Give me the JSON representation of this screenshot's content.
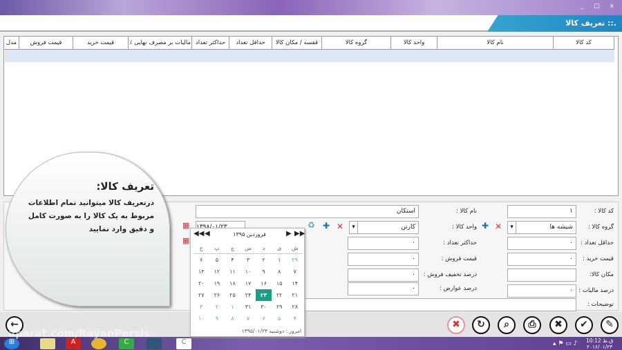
{
  "window": {
    "title": ".:: تعریف کالا",
    "controls": "_ ▢ x"
  },
  "grid": {
    "columns": [
      "مدل",
      "قیمت فروش",
      "قیمت خرید",
      "٪ مالیات بر مصرف نهایی",
      "حداکثر تعداد",
      "حداقل تعداد",
      "قفسه / مکان کالا",
      "گروه کالا",
      "واحد کالا",
      "نام کالا",
      "کد کالا"
    ]
  },
  "form": {
    "code_label": "کد کالا :",
    "code_value": "۱",
    "group_label": "گروه کالا :",
    "group_value": "شیشه ها",
    "min_label": "حداقل تعداد :",
    "min_value": "۰",
    "buy_label": "قیمت خرید :",
    "buy_value": "۰",
    "place_label": "مکان کالا:",
    "place_value": "",
    "tax_label": "درصد مالیات :",
    "tax_value": "۰",
    "desc_label": "توضیحات :",
    "name_label": "نام کالا :",
    "name_value": "استکان",
    "unit_label": "واحد کالا :",
    "unit_value": "کارتن",
    "max_label": "حداکثر تعداد :",
    "max_value": "۰",
    "sell_label": "قیمت فروش :",
    "sell_value": "۰",
    "discount_label": "درصد تخفیف فروش :",
    "discount_value": "۰",
    "duty_label": "درصد عوارض :",
    "duty_value": "۰",
    "date_value": "۱۳۹۸/۰۱/۲۳"
  },
  "calendar": {
    "month_title": "فروردین ۱۳۹۵",
    "weekdays": [
      "ش",
      "ی",
      "د",
      "س",
      "چ",
      "پ",
      "ج"
    ],
    "days": [
      "۲۹",
      "۱",
      "۲",
      "۳",
      "۴",
      "۵",
      "۶",
      "۷",
      "۸",
      "۹",
      "۱۰",
      "۱۱",
      "۱۲",
      "۱۳",
      "۱۴",
      "۱۵",
      "۱۶",
      "۱۷",
      "۱۸",
      "۱۹",
      "۲۰",
      "۲۱",
      "۲۲",
      "۲۳",
      "۲۴",
      "۲۵",
      "۲۶",
      "۲۷",
      "۲۸",
      "۲۹",
      "۳۰",
      "۳۱",
      "۱",
      "۲",
      "۳",
      "۴",
      "۵",
      "۶",
      "۷",
      "۸",
      "۹",
      "۱۰"
    ],
    "selected": "۲۳",
    "today": "امروز : دوشنبه ۱۳۹۵/۰۱/۲۳"
  },
  "bubble": {
    "title": "تعریف کالا:",
    "text": "درتعریف کالا میتوانید تمام اطلاعات مربوط به یک کالا را به صورت کامل و دقیق وارد نمایید"
  },
  "taskbar": {
    "time": "10:12 ق.ظ",
    "date": "۲۰۱۶/۰۱/۲۳"
  },
  "watermark": "aparat.com/RayanPersis",
  "colors": {
    "accent": "#1f86c4",
    "selected_day": "#1e9c86",
    "delete": "#d33"
  }
}
